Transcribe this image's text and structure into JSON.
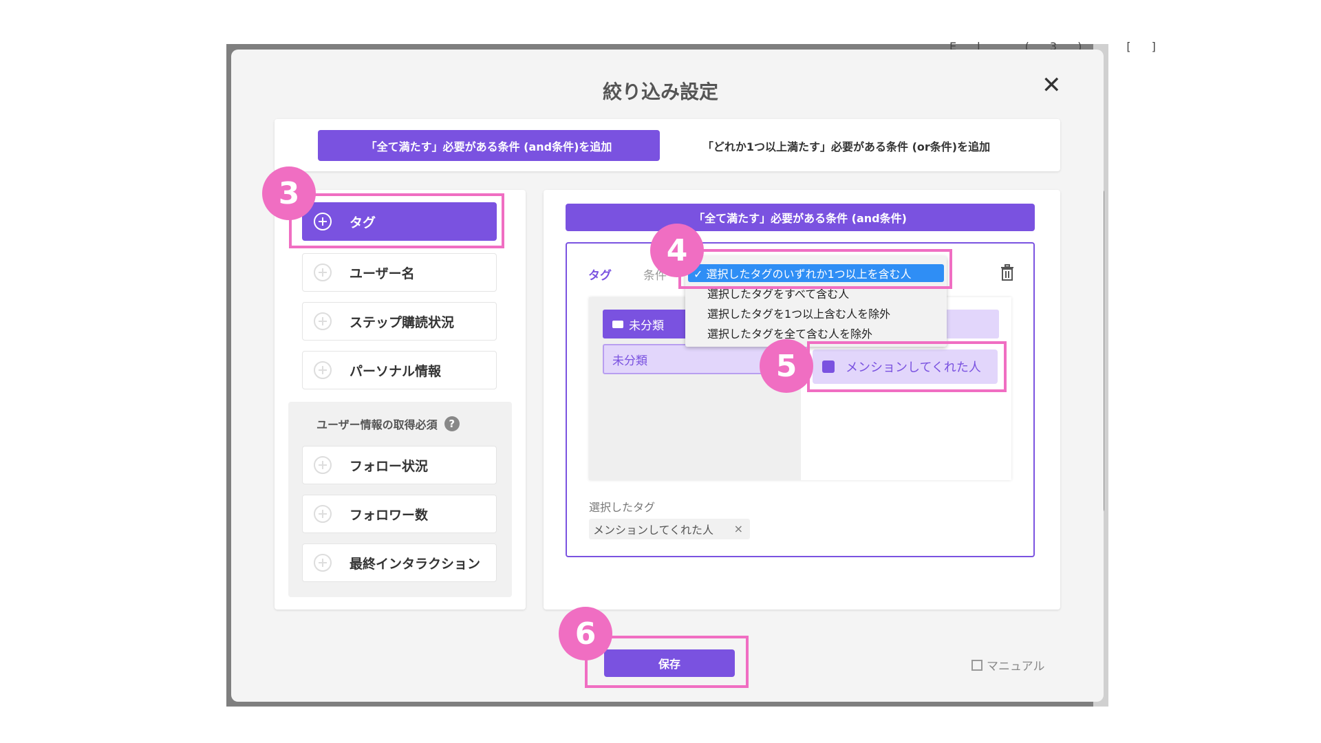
{
  "background": {
    "partial_text": "El  (3)  []"
  },
  "modal": {
    "title": "絞り込み設定",
    "close_icon": "close-icon"
  },
  "tabs": {
    "and_label": "「全て満たす」必要がある条件 (and条件)を追加",
    "or_label": "「どれか1つ以上満たす」必要がある条件 (or条件)を追加"
  },
  "left_items": [
    {
      "label": "タグ",
      "active": true
    },
    {
      "label": "ユーザー名"
    },
    {
      "label": "ステップ購読状況"
    },
    {
      "label": "パーソナル情報"
    }
  ],
  "required_section": {
    "label": "ユーザー情報の取得必須",
    "help": "?",
    "items": [
      {
        "label": "フォロー状況"
      },
      {
        "label": "フォロワー数"
      },
      {
        "label": "最終インタラクション"
      }
    ]
  },
  "condition": {
    "header": "「全て満たす」必要がある条件 (and条件)",
    "tag_label": "タグ",
    "cond_label": "条件",
    "dropdown": {
      "selected": "✓ 選択したタグのいずれか1つ以上を含む人",
      "options": [
        "選択したタグをすべて含む人",
        "選択したタグを1つ以上含む人を除外",
        "選択したタグを全て含む人を除外"
      ]
    },
    "folder_label": "未分類",
    "category_label": "未分類",
    "tag_item": "メンションしてくれた人",
    "selected_tags_label": "選択したタグ",
    "selected_tag": "メンションしてくれた人",
    "remove": "×"
  },
  "footer": {
    "save": "保存",
    "manual": "マニュアル"
  },
  "annotations": [
    "3",
    "4",
    "5",
    "6"
  ],
  "colors": {
    "accent": "#7a52e0",
    "highlight": "#f06ec2",
    "dropdown_selected": "#2f8ef5"
  }
}
